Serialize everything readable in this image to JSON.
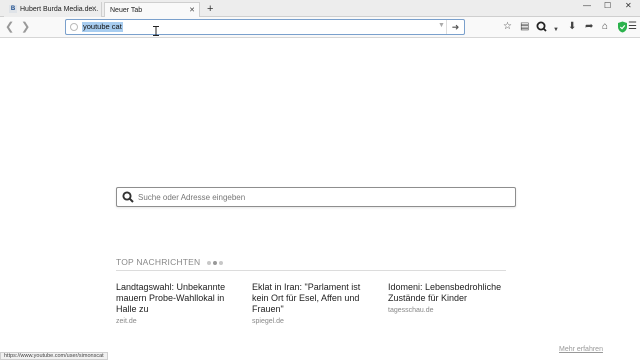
{
  "tabs": [
    {
      "label": "Hubert Burda Media.de...",
      "favicon": "B",
      "active": false
    },
    {
      "label": "Neuer Tab",
      "active": true
    }
  ],
  "nav": {
    "url_value": "youtube cat"
  },
  "search": {
    "placeholder": "Suche oder Adresse eingeben"
  },
  "news": {
    "heading": "TOP NACHRICHTEN",
    "articles": [
      {
        "title": "Landtagswahl: Unbekannte mauern Probe-Wahllokal in Halle zu",
        "source": "zeit.de"
      },
      {
        "title": "Eklat in Iran: \"Parlament ist kein Ort für Esel, Affen und Frauen\"",
        "source": "spiegel.de"
      },
      {
        "title": "Idomeni: Lebensbedrohliche Zustände für Kinder",
        "source": "tagesschau.de"
      }
    ],
    "more_label": "Mehr erfahren"
  },
  "status": {
    "text": "https://www.youtube.com/user/simonscat"
  },
  "icons": {
    "colors": {
      "url_highlight": "#a8cdf0",
      "shield": "#2bb24c",
      "focus_border": "#7aa0cc"
    }
  }
}
